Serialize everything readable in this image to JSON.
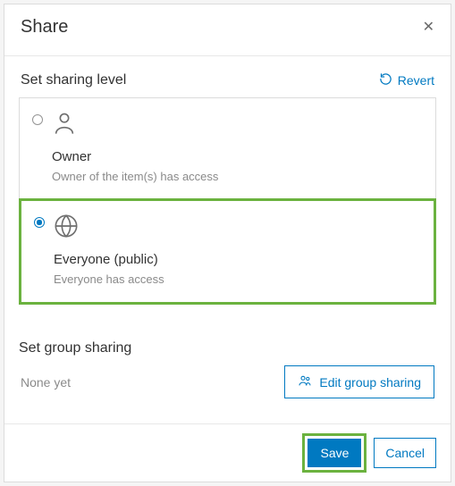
{
  "dialog": {
    "title": "Share",
    "close_aria": "Close"
  },
  "sharing_level": {
    "heading": "Set sharing level",
    "revert_label": "Revert",
    "options": [
      {
        "id": "owner",
        "label": "Owner",
        "description": "Owner of the item(s) has access",
        "selected": false
      },
      {
        "id": "everyone",
        "label": "Everyone (public)",
        "description": "Everyone has access",
        "selected": true
      }
    ]
  },
  "group_sharing": {
    "heading": "Set group sharing",
    "empty_text": "None yet",
    "edit_label": "Edit group sharing"
  },
  "footer": {
    "save_label": "Save",
    "cancel_label": "Cancel"
  }
}
